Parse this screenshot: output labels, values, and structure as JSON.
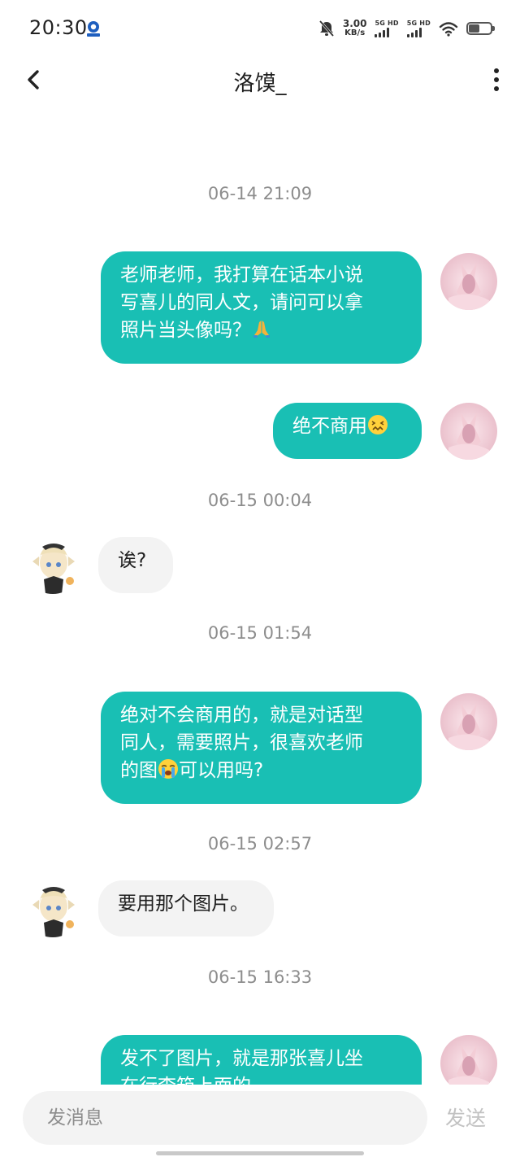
{
  "status_bar": {
    "time": "20:30",
    "net_speed": "3.00",
    "net_speed_unit": "KB/s",
    "sim1_label": "5G HD",
    "sim2_label": "5G HD",
    "battery_level": 0.45,
    "icons": [
      "app-notification-icon",
      "mute-icon",
      "signal-icon",
      "wifi-icon",
      "battery-icon"
    ]
  },
  "header": {
    "title": "洛馍_",
    "back_icon": "chevron-left-icon",
    "more_icon": "more-vertical-icon"
  },
  "colors": {
    "sent_bubble": "#19bfb4",
    "received_bubble": "#f3f3f3",
    "timestamp": "#8d8d8d"
  },
  "messages": {
    "t1": "06-14 21:09",
    "m1_line1": "老师老师，我打算在话本小说",
    "m1_line2": "写喜儿的同人文，请问可以拿",
    "m1_line3": "照片当头像吗？",
    "m1_emoji": "folded-hands-emoji",
    "m2_text": "绝不商用",
    "m2_emoji": "confounded-face-emoji",
    "t2": "06-15 00:04",
    "m3_text": "诶?",
    "t3": "06-15 01:54",
    "m4_line1": "绝对不会商用的，就是对话型",
    "m4_line2": "同人，需要照片，很喜欢老师",
    "m4_line3a": "的图",
    "m4_emoji": "loudly-crying-face-emoji",
    "m4_line3b": "可以用吗?",
    "t4": "06-15 02:57",
    "m5_text": "要用那个图片。",
    "t5": "06-15 16:33",
    "m6_line1": "发不了图片，就是那张喜儿坐",
    "m6_line2": "在行李箱上面的"
  },
  "input": {
    "placeholder": "发消息",
    "send_label": "发送"
  }
}
